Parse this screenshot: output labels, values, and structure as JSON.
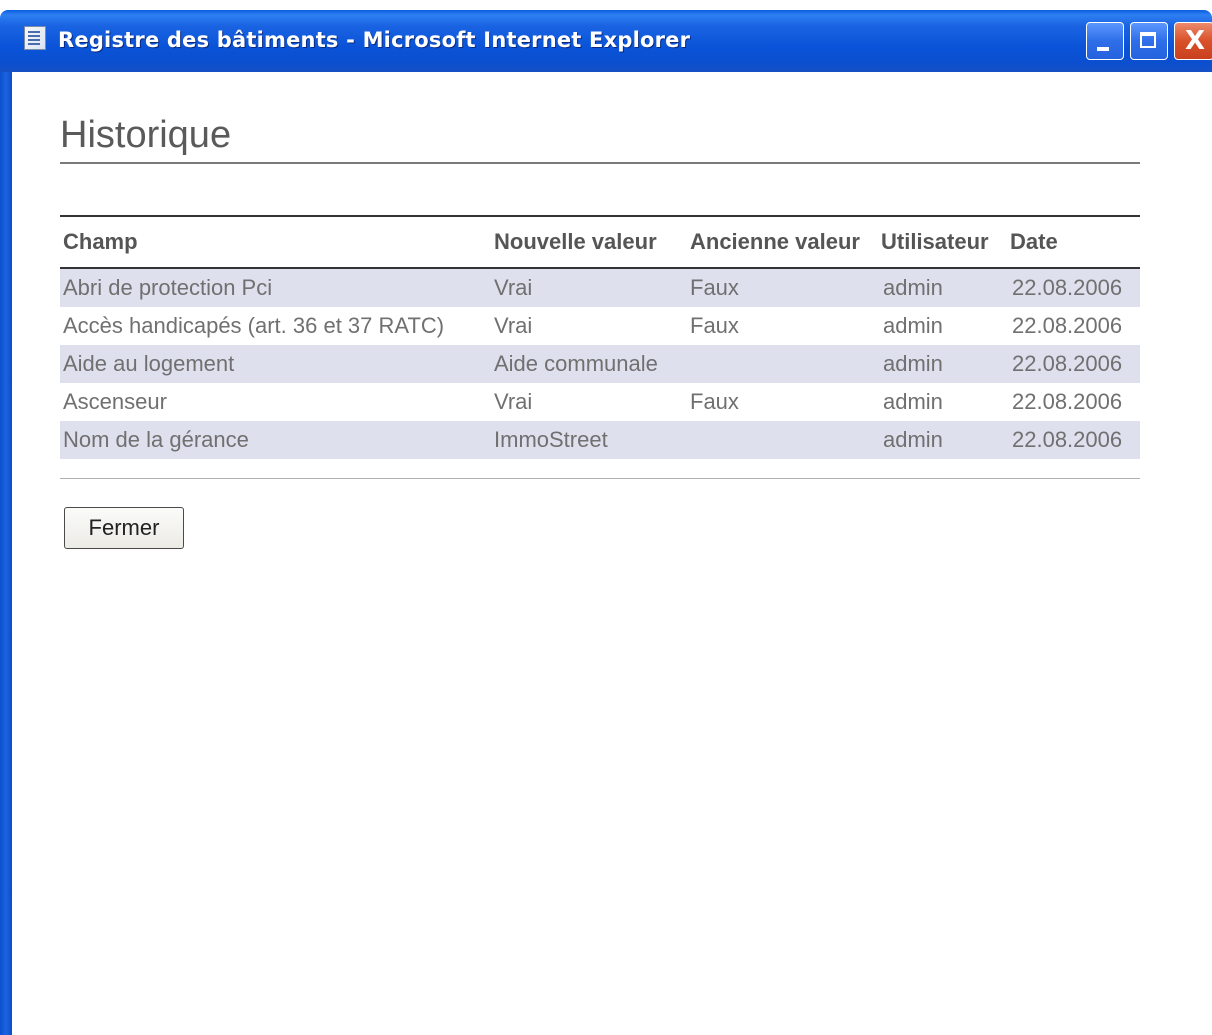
{
  "window": {
    "title": "Registre des bâtiments - Microsoft Internet Explorer",
    "close_glyph": "X"
  },
  "page": {
    "title": "Historique"
  },
  "table": {
    "headers": {
      "field": "Champ",
      "new_value": "Nouvelle valeur",
      "old_value": "Ancienne valeur",
      "user": "Utilisateur",
      "date": "Date"
    },
    "rows": [
      {
        "field": "Abri de protection Pci",
        "new_value": "Vrai",
        "old_value": "Faux",
        "user": "admin",
        "date": "22.08.2006"
      },
      {
        "field": "Accès handicapés (art. 36 et 37 RATC)",
        "new_value": "Vrai",
        "old_value": "Faux",
        "user": "admin",
        "date": "22.08.2006"
      },
      {
        "field": "Aide au logement",
        "new_value": "Aide communale",
        "old_value": "",
        "user": "admin",
        "date": "22.08.2006"
      },
      {
        "field": "Ascenseur",
        "new_value": "Vrai",
        "old_value": "Faux",
        "user": "admin",
        "date": "22.08.2006"
      },
      {
        "field": "Nom de la gérance",
        "new_value": "ImmoStreet",
        "old_value": "",
        "user": "admin",
        "date": "22.08.2006"
      }
    ]
  },
  "actions": {
    "close_label": "Fermer"
  }
}
